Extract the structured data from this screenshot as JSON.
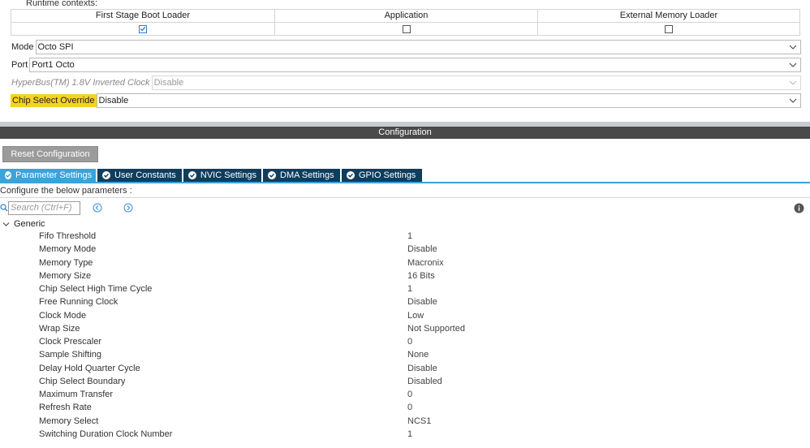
{
  "runtime": {
    "label": "Runtime contexts:",
    "columns": [
      {
        "name": "First Stage Boot Loader",
        "checked": true
      },
      {
        "name": "Application",
        "checked": false
      },
      {
        "name": "External Memory Loader",
        "checked": false
      }
    ]
  },
  "mode": {
    "label": "Mode",
    "value": "Octo SPI"
  },
  "port": {
    "label": "Port",
    "value": "Port1 Octo"
  },
  "hyperbus": {
    "label": "HyperBus(TM) 1.8V Inverted Clock",
    "value": "Disable"
  },
  "chip_select_override": {
    "label": "Chip Select Override",
    "value": "Disable",
    "highlight_color": "#f5d31f"
  },
  "configuration": {
    "header": "Configuration",
    "reset_button": "Reset Configuration",
    "tabs": [
      {
        "label": "Parameter Settings",
        "active": true
      },
      {
        "label": "User Constants",
        "active": false
      },
      {
        "label": "NVIC Settings",
        "active": false
      },
      {
        "label": "DMA Settings",
        "active": false
      },
      {
        "label": "GPIO Settings",
        "active": false
      }
    ],
    "note": "Configure the below parameters :",
    "search_placeholder": "Search (Ctrl+F)",
    "group": "Generic",
    "parameters": [
      {
        "name": "Fifo Threshold",
        "value": "1"
      },
      {
        "name": "Memory Mode",
        "value": "Disable"
      },
      {
        "name": "Memory Type",
        "value": "Macronix"
      },
      {
        "name": "Memory Size",
        "value": "16 Bits"
      },
      {
        "name": "Chip Select High Time Cycle",
        "value": "1"
      },
      {
        "name": "Free Running Clock",
        "value": "Disable"
      },
      {
        "name": "Clock Mode",
        "value": "Low"
      },
      {
        "name": "Wrap Size",
        "value": "Not Supported"
      },
      {
        "name": "Clock Prescaler",
        "value": "0"
      },
      {
        "name": "Sample Shifting",
        "value": "None"
      },
      {
        "name": "Delay Hold Quarter Cycle",
        "value": "Disable"
      },
      {
        "name": "Chip Select Boundary",
        "value": "Disabled"
      },
      {
        "name": "Maximum Transfer",
        "value": "0"
      },
      {
        "name": "Refresh Rate",
        "value": "0"
      },
      {
        "name": "Memory Select",
        "value": "NCS1"
      },
      {
        "name": "Switching Duration Clock Number",
        "value": "1"
      }
    ]
  },
  "colors": {
    "active_tab": "#3ca2da",
    "inactive_tab": "#0f3d5e",
    "header_bar": "#4a4a4a",
    "reset_button": "#9b9b9b"
  }
}
